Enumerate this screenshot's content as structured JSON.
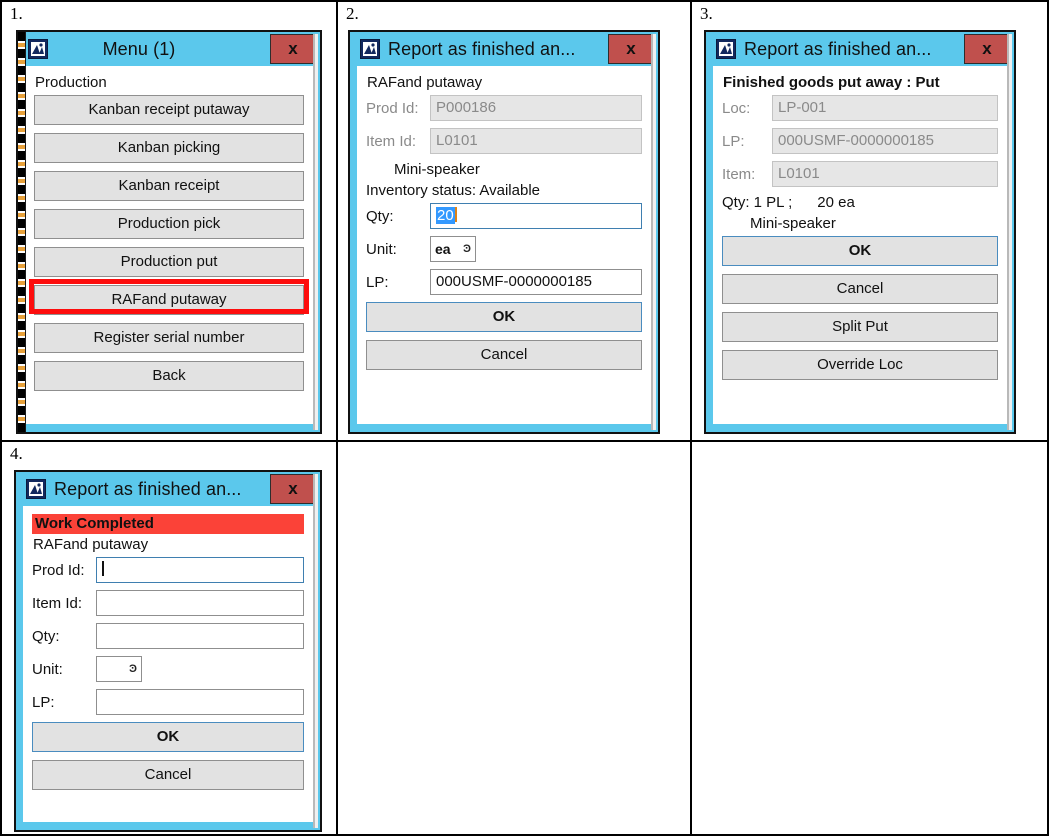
{
  "sheet": {
    "cell_numbers": [
      "1.",
      "2.",
      "3.",
      "4."
    ]
  },
  "icons": {
    "app": "device-app-icon",
    "close": "x",
    "dropdown": "⌄"
  },
  "panel1": {
    "title": "Menu (1)",
    "close_label": "x",
    "section": "Production",
    "buttons": [
      {
        "label": "Kanban receipt putaway",
        "highlight": false
      },
      {
        "label": "Kanban picking",
        "highlight": false
      },
      {
        "label": "Kanban receipt",
        "highlight": false
      },
      {
        "label": "Production pick",
        "highlight": false
      },
      {
        "label": "Production put",
        "highlight": false
      },
      {
        "label": "RAFand putaway",
        "highlight": true
      },
      {
        "label": "Register serial number",
        "highlight": false
      },
      {
        "label": "Back",
        "highlight": false
      }
    ],
    "highlight_color": "#fd0d0d"
  },
  "panel2": {
    "title": "Report as finished an...",
    "close_label": "x",
    "heading": "RAFand putaway",
    "fields": [
      {
        "label": "Prod Id:",
        "value": "P000186",
        "disabled": true
      },
      {
        "label": "Item Id:",
        "value": "L0101",
        "disabled": true
      }
    ],
    "item_name": "Mini-speaker",
    "inventory_status": "Inventory status: Available",
    "qty_label": "Qty:",
    "qty_value": "20",
    "unit_label": "Unit:",
    "unit_value": "ea",
    "lp_label": "LP:",
    "lp_value": "000USMF-0000000185",
    "ok_label": "OK",
    "cancel_label": "Cancel"
  },
  "panel3": {
    "title": "Report as finished an...",
    "close_label": "x",
    "heading": "Finished goods put away : Put",
    "fields": [
      {
        "label": "Loc:",
        "value": "LP-001",
        "disabled": true
      },
      {
        "label": "LP:",
        "value": "000USMF-0000000185",
        "disabled": true
      },
      {
        "label": "Item:",
        "value": "L0101",
        "disabled": true
      }
    ],
    "qty_line": "Qty: 1 PL ;      20 ea",
    "item_name": "Mini-speaker",
    "buttons": [
      {
        "label": "OK",
        "primary": true
      },
      {
        "label": "Cancel",
        "primary": false
      },
      {
        "label": "Split Put",
        "primary": false
      },
      {
        "label": "Override Loc",
        "primary": false
      }
    ]
  },
  "panel4": {
    "title": "Report as finished an...",
    "close_label": "x",
    "banner": "Work Completed",
    "banner_color": "#fb4238",
    "heading": "RAFand putaway",
    "fields": [
      {
        "label": "Prod Id:",
        "value": "",
        "focused": true,
        "type": "text"
      },
      {
        "label": "Item Id:",
        "value": "",
        "focused": false,
        "type": "text"
      },
      {
        "label": "Qty:",
        "value": "",
        "focused": false,
        "type": "text"
      },
      {
        "label": "Unit:",
        "value": "",
        "focused": false,
        "type": "select"
      },
      {
        "label": "LP:",
        "value": "",
        "focused": false,
        "type": "text"
      }
    ],
    "ok_label": "OK",
    "cancel_label": "Cancel"
  }
}
